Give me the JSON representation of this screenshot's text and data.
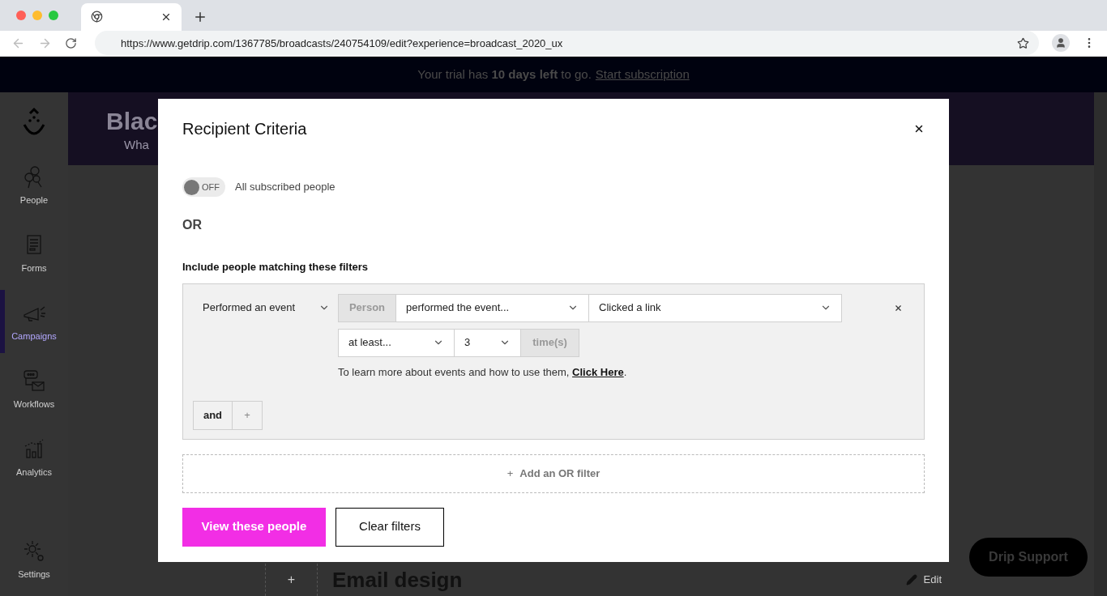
{
  "browser": {
    "url": "https://www.getdrip.com/1367785/broadcasts/240754109/edit?experience=broadcast_2020_ux"
  },
  "banner": {
    "text": "Your trial has **10 days left** to go.",
    "link": "Start subscription"
  },
  "sidebar": {
    "items": [
      {
        "label": "People",
        "selected": false
      },
      {
        "label": "Forms",
        "selected": false
      },
      {
        "label": "Campaigns",
        "selected": true
      },
      {
        "label": "Workflows",
        "selected": false
      },
      {
        "label": "Analytics",
        "selected": false
      },
      {
        "label": "Settings",
        "selected": false
      }
    ]
  },
  "page": {
    "title": "Blac",
    "subtitle": "Wha",
    "add_block": "+",
    "section_title": "Email design",
    "edit": "Edit",
    "support": "Drip Support"
  },
  "modal": {
    "title": "Recipient Criteria",
    "toggle": {
      "on": false,
      "label": "OFF"
    },
    "toggle_label": "All subscribed people",
    "or_label": "OR",
    "filters_heading": "Include people matching these filters",
    "filter": {
      "type": "Performed an event",
      "subject": "Person",
      "verb": "performed the event...",
      "event": "Clicked a link",
      "qualifier": "at least...",
      "count": "3",
      "unit": "time(s)",
      "help_text": "To learn more about events and how to use them,",
      "help_link": "Click Here",
      "help_end": "."
    },
    "and_button": "and",
    "add_button": "+",
    "add_or": {
      "icon": "+",
      "label": "Add an OR filter"
    },
    "buttons": [
      {
        "label": "View these people",
        "kind": "primary"
      },
      {
        "label": "Clear filters",
        "kind": "secondary"
      }
    ]
  }
}
